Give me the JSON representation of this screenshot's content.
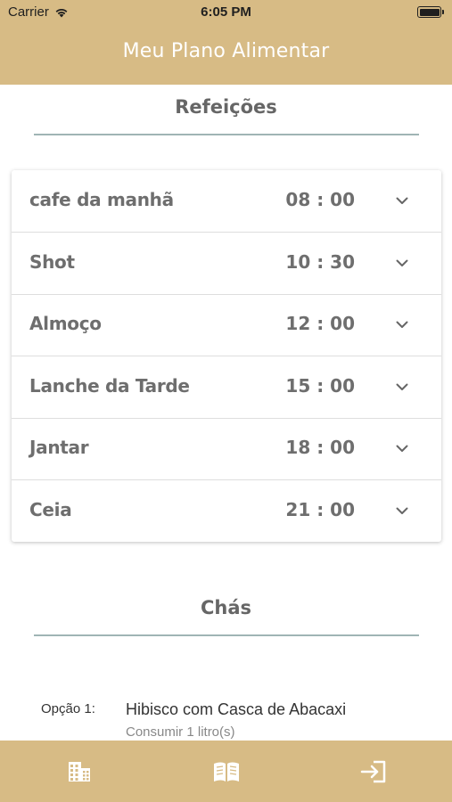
{
  "status_bar": {
    "carrier": "Carrier",
    "time": "6:05 PM",
    "wifi_icon": "wifi-icon",
    "battery_icon": "battery-icon"
  },
  "header": {
    "title": "Meu Plano Alimentar",
    "color": "#d7bb85"
  },
  "meals": {
    "section_title": "Refeições",
    "items": [
      {
        "name": "cafe da manhã",
        "time": "08 : 00"
      },
      {
        "name": "Shot",
        "time": "10 : 30"
      },
      {
        "name": "Almoço",
        "time": "12 : 00"
      },
      {
        "name": "Lanche da Tarde",
        "time": "15 : 00"
      },
      {
        "name": "Jantar",
        "time": "18 : 00"
      },
      {
        "name": "Ceia",
        "time": "21 : 00"
      }
    ],
    "expand_icon": "chevron-down-icon"
  },
  "teas": {
    "section_title": "Chás",
    "options": [
      {
        "label": "Opção 1:",
        "name": "Hibisco com Casca de Abacaxi",
        "note": "Consumir 1 litro(s)"
      }
    ]
  },
  "tab_bar": {
    "tabs": [
      {
        "icon": "building-icon"
      },
      {
        "icon": "book-icon"
      },
      {
        "icon": "logout-icon"
      }
    ]
  }
}
